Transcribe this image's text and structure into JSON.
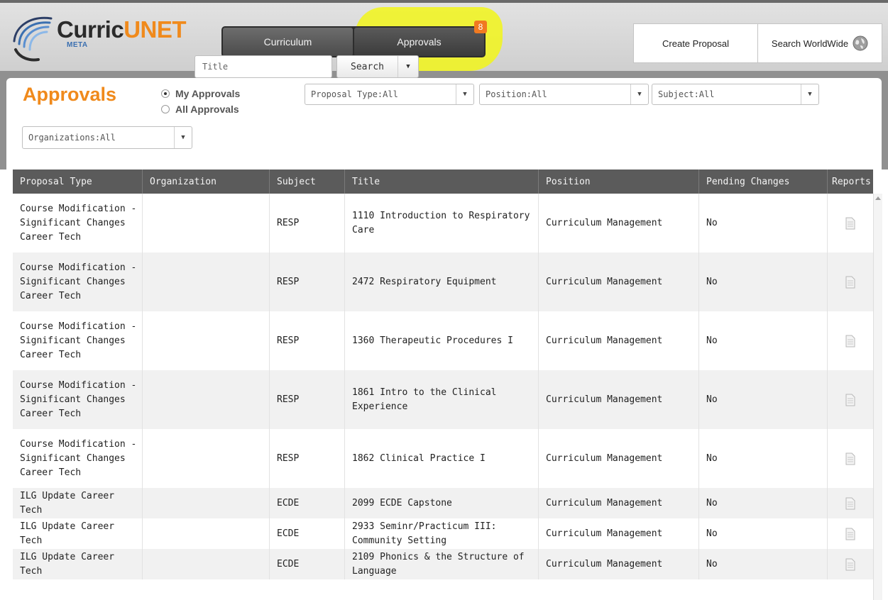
{
  "header": {
    "logo_main": "Curric",
    "logo_accent": "UNET",
    "logo_sub": "META",
    "nav": [
      {
        "label": "Curriculum"
      },
      {
        "label": "Approvals"
      }
    ],
    "approvals_badge": "8",
    "create_proposal": "Create Proposal",
    "search_worldwide": "Search WorldWide"
  },
  "filters": {
    "page_title": "Approvals",
    "radio_my": "My Approvals",
    "radio_all": "All Approvals",
    "proposal_type": "Proposal Type:All",
    "position": "Position:All",
    "subject": "Subject:All",
    "organizations": "Organizations:All",
    "title_placeholder": "Title",
    "search": "Search"
  },
  "table": {
    "columns": [
      "Proposal Type",
      "Organization",
      "Subject",
      "Title",
      "Position",
      "Pending Changes",
      "Reports"
    ],
    "rows": [
      {
        "type": "Course Modification - Significant Changes Career Tech",
        "org": "",
        "subject": "RESP",
        "title": "1110 Introduction to Respiratory Care",
        "position": "Curriculum Management",
        "pending": "No"
      },
      {
        "type": "Course Modification - Significant Changes Career Tech",
        "org": "",
        "subject": "RESP",
        "title": "2472 Respiratory Equipment",
        "position": "Curriculum Management",
        "pending": "No"
      },
      {
        "type": "Course Modification - Significant Changes Career Tech",
        "org": "",
        "subject": "RESP",
        "title": "1360 Therapeutic Procedures I",
        "position": "Curriculum Management",
        "pending": "No"
      },
      {
        "type": "Course Modification - Significant Changes Career Tech",
        "org": "",
        "subject": "RESP",
        "title": "1861 Intro to the Clinical Experience",
        "position": "Curriculum Management",
        "pending": "No"
      },
      {
        "type": "Course Modification - Significant Changes Career Tech",
        "org": "",
        "subject": "RESP",
        "title": "1862 Clinical Practice I",
        "position": "Curriculum Management",
        "pending": "No"
      },
      {
        "type": "ILG Update Career Tech",
        "org": "",
        "subject": "ECDE",
        "title": "2099 ECDE Capstone",
        "position": "Curriculum Management",
        "pending": "No"
      },
      {
        "type": "ILG Update Career Tech",
        "org": "",
        "subject": "ECDE",
        "title": "2933 Seminr/Practicum III: Community Setting",
        "position": "Curriculum Management",
        "pending": "No"
      },
      {
        "type": "ILG Update Career Tech",
        "org": "",
        "subject": "ECDE",
        "title": "2109 Phonics & the Structure of Language",
        "position": "Curriculum Management",
        "pending": "No"
      }
    ]
  }
}
